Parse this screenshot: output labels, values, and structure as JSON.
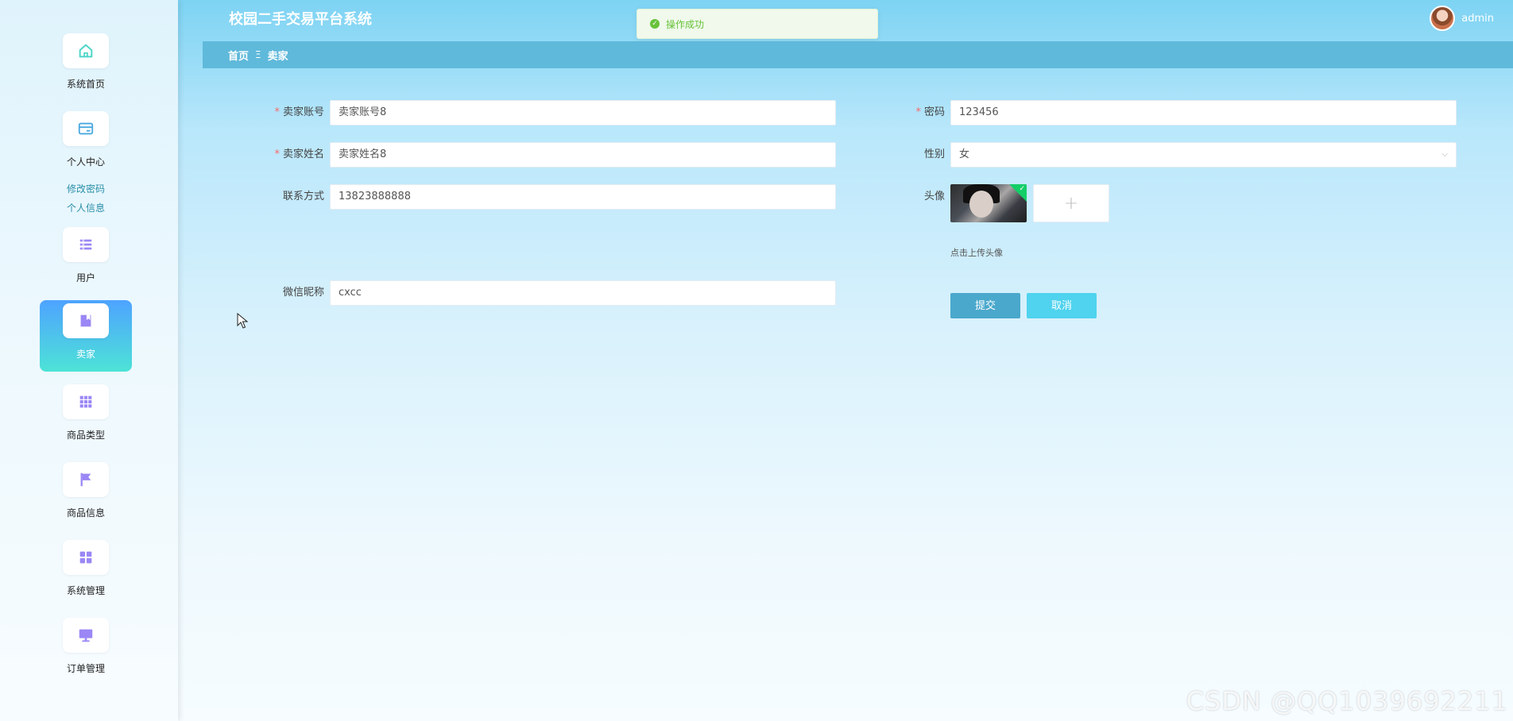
{
  "app": {
    "title": "校园二手交易平台系统"
  },
  "user": {
    "name": "admin"
  },
  "toast": {
    "message": "操作成功"
  },
  "breadcrumb": {
    "home": "首页",
    "separator": "Ξ",
    "current": "卖家"
  },
  "sidebar": {
    "items": [
      {
        "label": "系统首页",
        "icon": "home-icon"
      },
      {
        "label": "个人中心",
        "icon": "card-icon",
        "submenu": [
          "修改密码",
          "个人信息"
        ]
      },
      {
        "label": "用户",
        "icon": "list-icon"
      },
      {
        "label": "卖家",
        "icon": "book-icon",
        "active": true
      },
      {
        "label": "商品类型",
        "icon": "grid-icon"
      },
      {
        "label": "商品信息",
        "icon": "flag-icon"
      },
      {
        "label": "系统管理",
        "icon": "tiles-icon"
      },
      {
        "label": "订单管理",
        "icon": "monitor-icon"
      }
    ]
  },
  "form": {
    "account": {
      "label": "卖家账号",
      "value": "卖家账号8",
      "required": true
    },
    "password": {
      "label": "密码",
      "value": "123456",
      "required": true
    },
    "name": {
      "label": "卖家姓名",
      "value": "卖家姓名8",
      "required": true
    },
    "gender": {
      "label": "性别",
      "value": "女"
    },
    "phone": {
      "label": "联系方式",
      "value": "13823888888"
    },
    "avatar": {
      "label": "头像",
      "hint": "点击上传头像",
      "add_symbol": "+"
    },
    "wechat": {
      "label": "微信昵称",
      "value": "cxcc"
    },
    "submit_label": "提交",
    "cancel_label": "取消"
  },
  "colors": {
    "accent": "#5fb9da",
    "active_gradient_start": "#4ea3ff",
    "active_gradient_end": "#4de3d7",
    "required": "#f56c6c",
    "success": "#67c23a",
    "icon": "#9b87f5"
  },
  "watermark": "CSDN @QQ1039692211"
}
